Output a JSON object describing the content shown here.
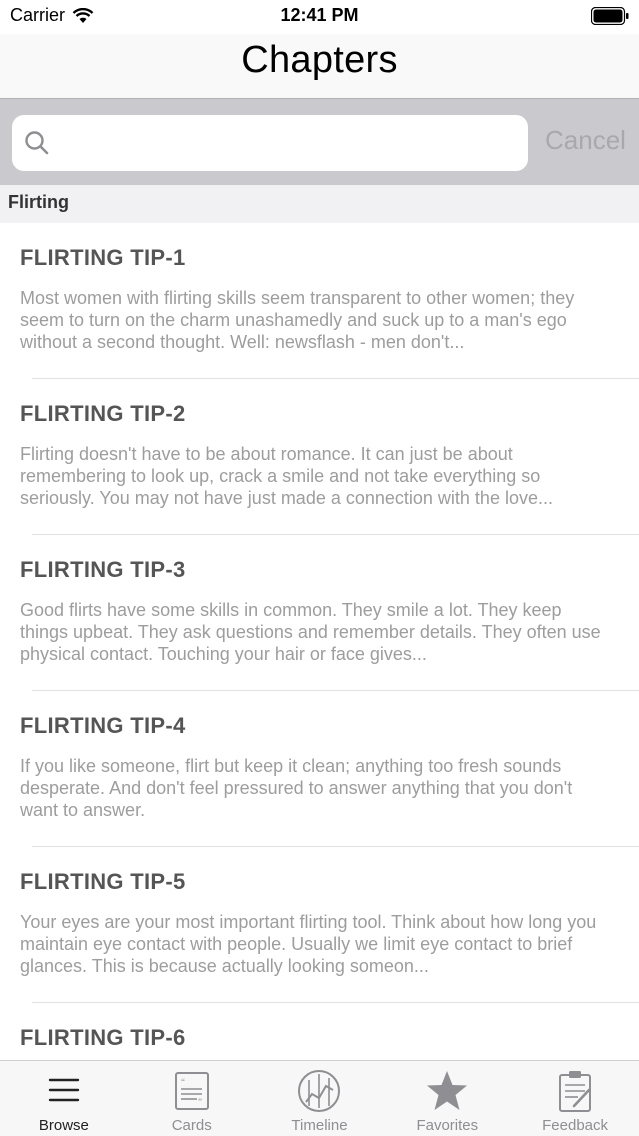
{
  "status_bar": {
    "carrier": "Carrier",
    "time": "12:41 PM"
  },
  "nav": {
    "title": "Chapters"
  },
  "search": {
    "placeholder": "",
    "cancel_label": "Cancel"
  },
  "section": {
    "title": "Flirting"
  },
  "rows": [
    {
      "title": "FLIRTING TIP-1",
      "body": "Most women with flirting skills seem transparent to other women; they seem to turn on the charm unashamedly and suck up to a man's ego without a second thought. Well: newsflash - men don't..."
    },
    {
      "title": "FLIRTING TIP-2",
      "body": "Flirting doesn't have to be about romance. It can just be about remembering to look up, crack a smile and not take everything so seriously. You may not have just made a connection with the love..."
    },
    {
      "title": "FLIRTING TIP-3",
      "body": "Good flirts have some skills in common. They smile a lot. They keep things upbeat. They ask questions and remember details. They often use physical contact. Touching your hair or face gives..."
    },
    {
      "title": "FLIRTING TIP-4",
      "body": "If you like someone, flirt but keep it clean; anything too fresh sounds desperate. And don't feel pressured to answer anything that you don't want to answer."
    },
    {
      "title": "FLIRTING TIP-5",
      "body": "Your eyes are your most important flirting tool. Think about how long you maintain eye contact with people. Usually we limit eye contact to brief glances. This is because actually looking someon..."
    },
    {
      "title": "FLIRTING TIP-6",
      "body": ""
    }
  ],
  "tabs": [
    {
      "label": "Browse",
      "icon": "menu-lines-icon",
      "active": true
    },
    {
      "label": "Cards",
      "icon": "cards-icon",
      "active": false
    },
    {
      "label": "Timeline",
      "icon": "timeline-icon",
      "active": false
    },
    {
      "label": "Favorites",
      "icon": "star-icon",
      "active": false
    },
    {
      "label": "Feedback",
      "icon": "clipboard-icon",
      "active": false
    }
  ],
  "colors": {
    "tab_active": "#222222",
    "tab_inactive": "#8e8e93",
    "search_bg": "#c9c9ce"
  }
}
